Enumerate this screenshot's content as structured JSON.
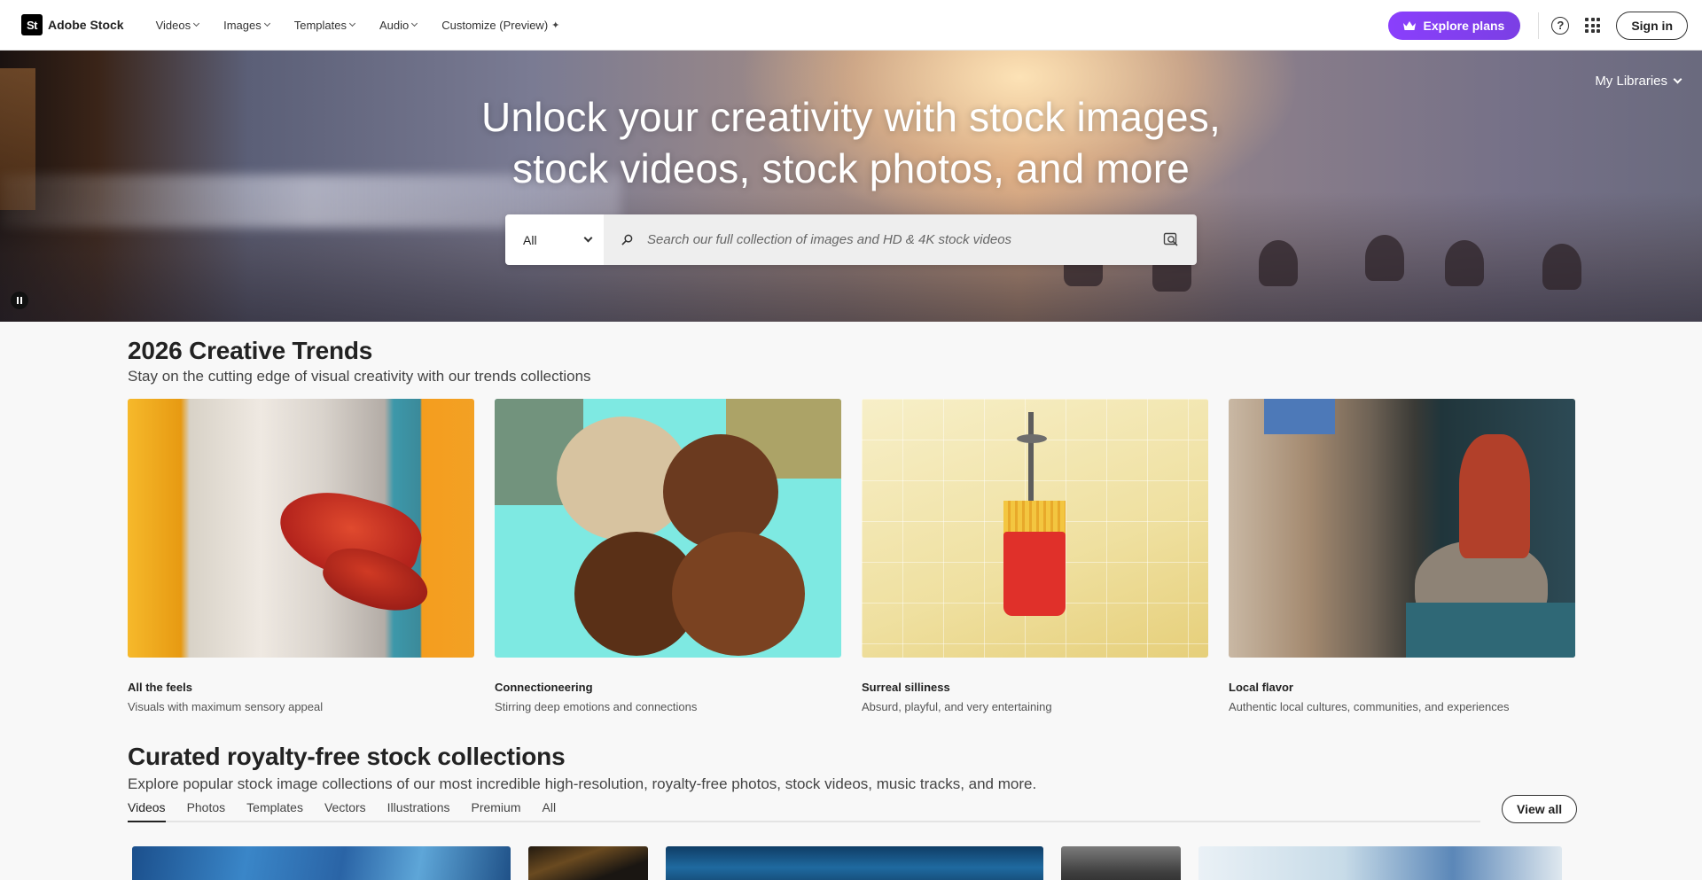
{
  "app": {
    "logo_text": "St",
    "brand_name": "Adobe Stock"
  },
  "nav": {
    "items": [
      {
        "label": "Videos",
        "has_dropdown": true
      },
      {
        "label": "Images",
        "has_dropdown": true
      },
      {
        "label": "Templates",
        "has_dropdown": true
      },
      {
        "label": "Audio",
        "has_dropdown": true
      },
      {
        "label": "Customize (Preview)",
        "has_dropdown": false
      }
    ],
    "explore_plans": "Explore plans",
    "sign_in": "Sign in"
  },
  "hero": {
    "title_line1": "Unlock your creativity with stock images,",
    "title_line2": "stock videos, stock photos, and more",
    "my_libraries": "My Libraries",
    "search_type_selected": "All",
    "search_placeholder": "Search our full collection of images and HD & 4K stock videos"
  },
  "trends": {
    "title": "2026 Creative Trends",
    "subtitle": "Stay on the cutting edge of visual creativity with our trends collections",
    "cards": [
      {
        "name": "All the feels",
        "desc": "Visuals with maximum sensory appeal"
      },
      {
        "name": "Connectioneering",
        "desc": "Stirring deep emotions and connections"
      },
      {
        "name": "Surreal silliness",
        "desc": "Absurd, playful, and very entertaining"
      },
      {
        "name": "Local flavor",
        "desc": "Authentic local cultures, communities, and experiences"
      }
    ]
  },
  "curated": {
    "title": "Curated royalty-free stock collections",
    "subtitle": "Explore popular stock image collections of our most incredible high-resolution, royalty-free photos, stock videos, music tracks, and more.",
    "tabs": [
      "Videos",
      "Photos",
      "Templates",
      "Vectors",
      "Illustrations",
      "Premium",
      "All"
    ],
    "active_tab": "Videos",
    "view_all": "View all"
  },
  "colors": {
    "accent_purple": "#8a3ffc",
    "text_dark": "#222222",
    "page_bg": "#f8f8f8"
  }
}
